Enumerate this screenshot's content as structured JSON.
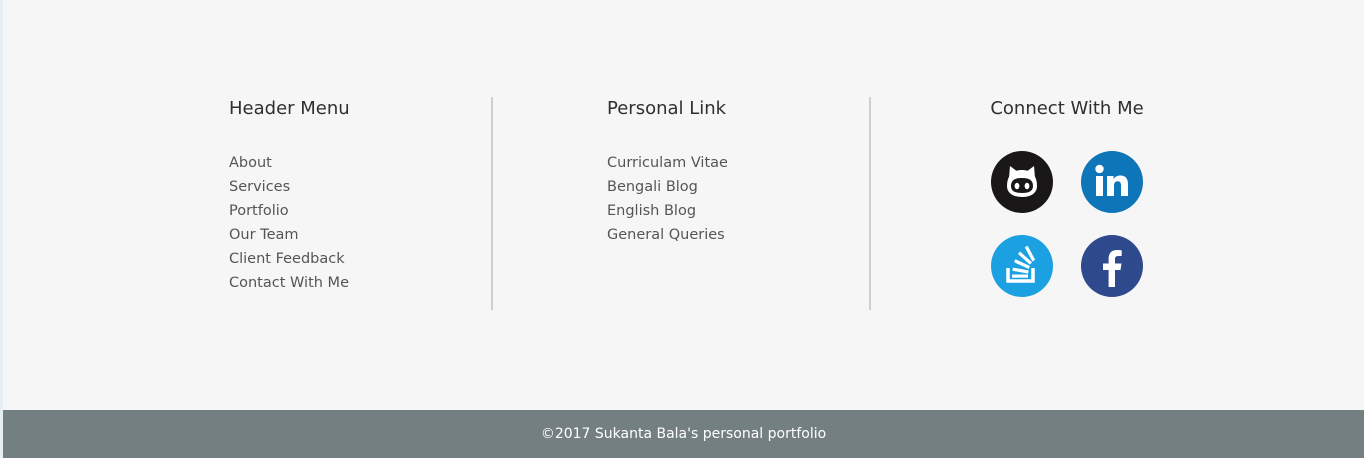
{
  "columns": {
    "header_menu": {
      "title": "Header Menu",
      "links": [
        "About",
        "Services",
        "Portfolio",
        "Our Team",
        "Client Feedback",
        "Contact With Me"
      ]
    },
    "personal_link": {
      "title": "Personal Link",
      "links": [
        "Curriculam Vitae",
        "Bengali Blog",
        "English Blog",
        "General Queries"
      ]
    },
    "connect": {
      "title": "Connect With Me",
      "icons": [
        "github-icon",
        "linkedin-icon",
        "stackoverflow-icon",
        "facebook-icon"
      ]
    }
  },
  "colors": {
    "footer_bg": "#f6f6f6",
    "bar_bg": "#737f80",
    "github": "#191717",
    "linkedin": "#0e76b8",
    "stackoverflow": "#1ba1e2",
    "facebook": "#2e4a8c"
  },
  "footer_bar": {
    "copyright": "©2017 Sukanta Bala's personal portfolio"
  }
}
